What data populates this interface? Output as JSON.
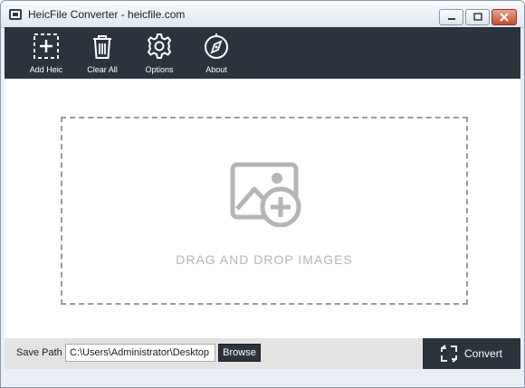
{
  "window": {
    "title": "HeicFile Converter - heicfile.com"
  },
  "toolbar": {
    "items": [
      {
        "label": "Add Heic",
        "icon": "add-icon"
      },
      {
        "label": "Clear All",
        "icon": "trash-icon"
      },
      {
        "label": "Options",
        "icon": "gear-icon"
      },
      {
        "label": "About",
        "icon": "compass-icon"
      }
    ]
  },
  "drop_zone": {
    "text": "DRAG AND DROP IMAGES",
    "icon": "image-add-icon"
  },
  "bottom": {
    "save_path_label": "Save Path",
    "save_path_value": "C:\\Users\\Administrator\\Desktop",
    "browse_label": "Browse",
    "convert_label": "Convert",
    "convert_icon": "convert-icon"
  },
  "colors": {
    "toolbar_bg": "#2b333d",
    "drop_border": "#9a9a9a",
    "drop_text": "#b7b7b7",
    "close_button": "#c94a33"
  }
}
